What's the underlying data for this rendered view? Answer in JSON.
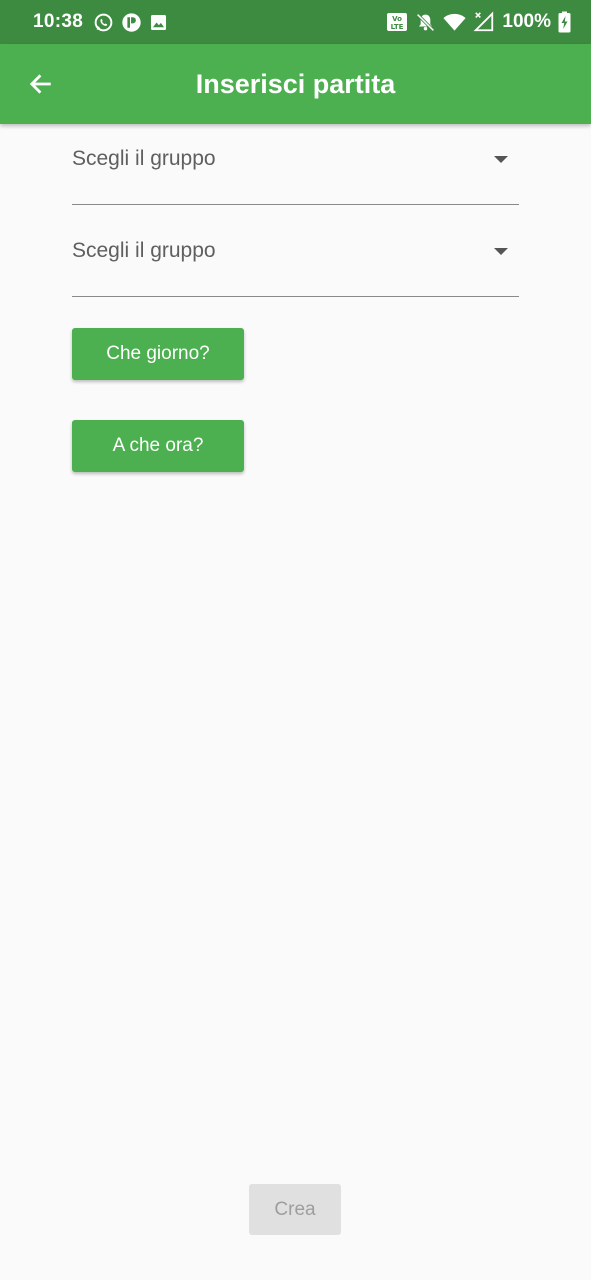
{
  "status_bar": {
    "time": "10:38",
    "left_icons": [
      "whatsapp-icon",
      "app-p-icon",
      "image-icon"
    ],
    "right_icons": [
      "volte-icon",
      "notifications-off-icon",
      "wifi-icon",
      "signal-icon",
      "battery-charging-icon"
    ],
    "battery": "100%",
    "background_color": "#3d8b40"
  },
  "app_bar": {
    "title": "Inserisci partita",
    "back_icon": "arrow-back-icon",
    "background_color": "#4caf50"
  },
  "form": {
    "group_select_1": {
      "label": "Scegli il gruppo",
      "icon": "dropdown-arrow-icon"
    },
    "group_select_2": {
      "label": "Scegli il gruppo",
      "icon": "dropdown-arrow-icon"
    },
    "day_button": {
      "label": "Che giorno?"
    },
    "time_button": {
      "label": "A che ora?"
    },
    "create_button": {
      "label": "Crea",
      "enabled": false
    }
  },
  "colors": {
    "accent": "#4caf50",
    "disabled_bg": "#e0e0e0",
    "disabled_text": "#9e9e9e",
    "background": "#fafafa"
  }
}
